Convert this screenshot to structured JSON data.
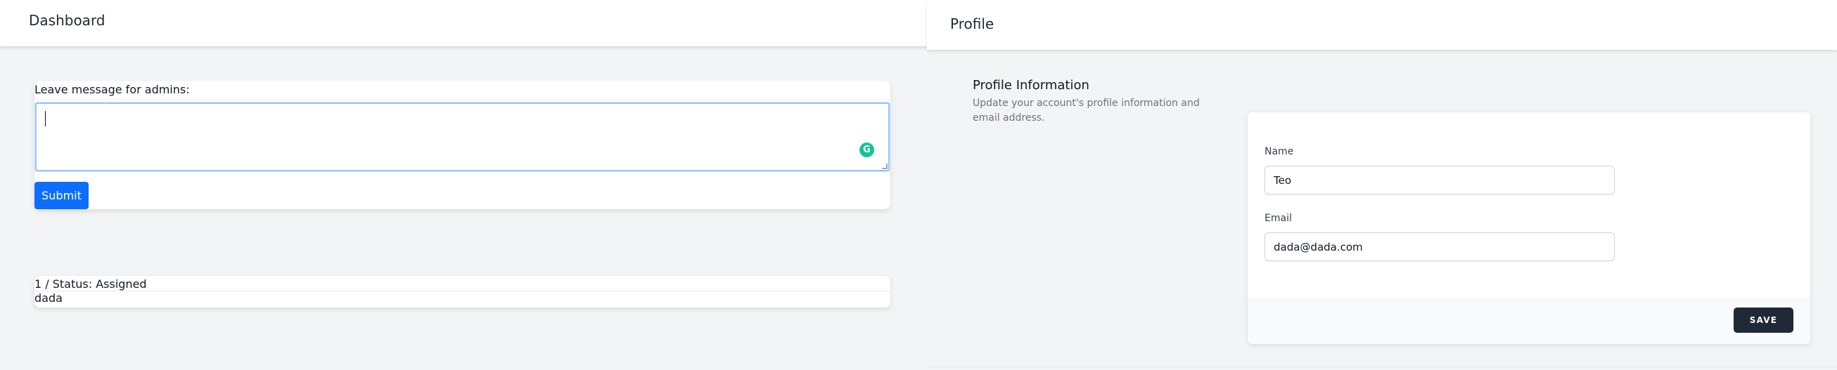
{
  "dashboard": {
    "title": "Dashboard",
    "message_label": "Leave message for admins:",
    "textarea_value": "",
    "submit_label": "Submit",
    "status": {
      "line": "1 / Status: Assigned",
      "body": "dada"
    }
  },
  "profile": {
    "title": "Profile",
    "section_title": "Profile Information",
    "section_description": "Update your account's profile information and email address.",
    "name_label": "Name",
    "name_value": "Teo",
    "email_label": "Email",
    "email_value": "dada@dada.com",
    "save_label": "SAVE"
  },
  "icons": {
    "grammarly": "grammarly-icon",
    "grammarly_glyph": "G",
    "resize": "resize-handle-icon"
  },
  "colors": {
    "submit_button": "#0d6efd",
    "save_button": "#1f2937",
    "textarea_focus": "#93c5fd",
    "grammarly": "#15c39a"
  }
}
